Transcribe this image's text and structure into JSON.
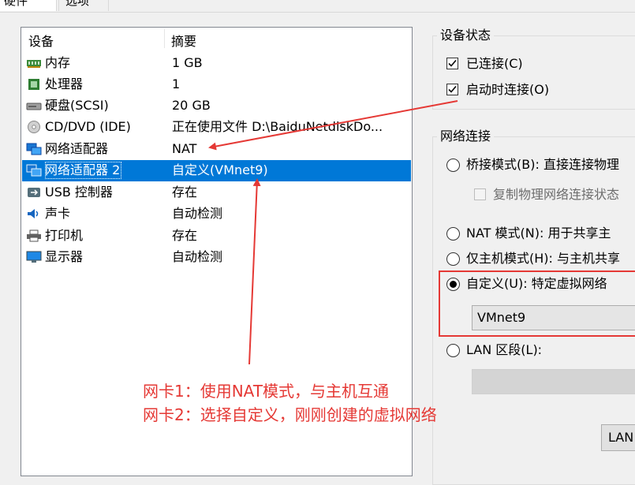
{
  "tabs": [
    "硬件",
    "选项"
  ],
  "device_list": {
    "header_device": "设备",
    "header_summary": "摘要",
    "rows": [
      {
        "name": "内存",
        "summary": "1 GB",
        "icon": "memory-icon"
      },
      {
        "name": "处理器",
        "summary": "1",
        "icon": "processor-icon"
      },
      {
        "name": "硬盘(SCSI)",
        "summary": "20 GB",
        "icon": "harddisk-icon"
      },
      {
        "name": "CD/DVD (IDE)",
        "summary": "正在使用文件 D:\\BaiduNetdiskDo...",
        "icon": "cd-dvd-icon"
      },
      {
        "name": "网络适配器",
        "summary": "NAT",
        "icon": "network-adapter-icon"
      },
      {
        "name": "网络适配器 2",
        "summary": "自定义(VMnet9)",
        "icon": "network-adapter-icon",
        "selected": true
      },
      {
        "name": "USB 控制器",
        "summary": "存在",
        "icon": "usb-icon"
      },
      {
        "name": "声卡",
        "summary": "自动检测",
        "icon": "sound-card-icon"
      },
      {
        "name": "打印机",
        "summary": "存在",
        "icon": "printer-icon"
      },
      {
        "name": "显示器",
        "summary": "自动检测",
        "icon": "display-icon"
      }
    ]
  },
  "device_status": {
    "title": "设备状态",
    "connected": "已连接(C)",
    "connect_at_power_on": "启动时连接(O)",
    "connected_checked": true,
    "connect_at_power_on_checked": true
  },
  "network": {
    "title": "网络连接",
    "bridged": "桥接模式(B): 直接连接物理",
    "replicate": "复制物理网络连接状态",
    "nat": "NAT 模式(N): 用于共享主",
    "host_only": "仅主机模式(H): 与主机共享",
    "custom": "自定义(U): 特定虚拟网络",
    "custom_value": "VMnet9",
    "lan": "LAN 区段(L):",
    "lan_button": "LAN",
    "selected": "custom"
  },
  "annotations": {
    "line1": "网卡1：使用NAT模式，与主机互通",
    "line2": "网卡2：选择自定义，刚刚创建的虚拟网络",
    "color": "#e53935"
  },
  "colors": {
    "selection": "#0078d7",
    "annotation": "#e53935"
  }
}
